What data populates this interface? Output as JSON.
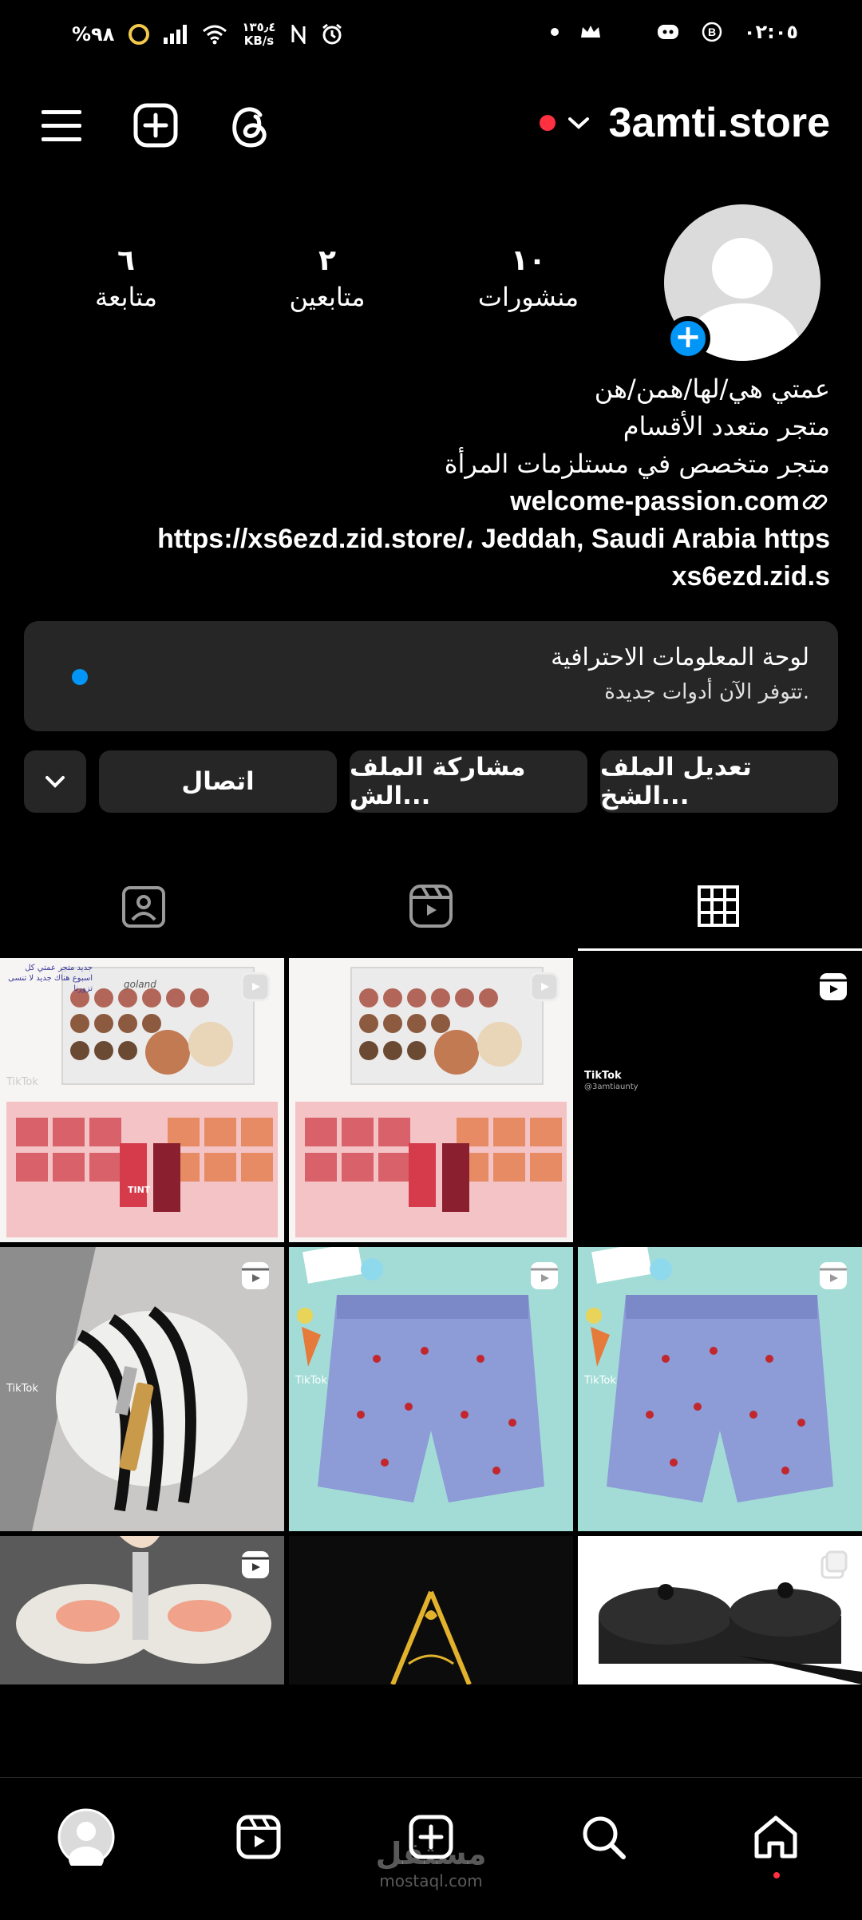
{
  "status_bar": {
    "battery": "%٩٨",
    "speed_value": "١٣٥٫٤",
    "speed_unit": "KB/s",
    "time": "٠٢:٠٥"
  },
  "header": {
    "username": "3amti.store"
  },
  "stats": {
    "posts_count": "١٠",
    "posts_label": "منشورات",
    "followers_count": "٢",
    "followers_label": "متابعين",
    "following_count": "٦",
    "following_label": "متابعة"
  },
  "bio": {
    "line1": "عمتي هي/لها/همن/هن",
    "line2": "متجر متعدد الأقسام",
    "line3": "متجر متخصص في مستلزمات المرأة",
    "link": "welcome-passion.com",
    "line5": "https://xs6ezd.zid.store/، Jeddah, Saudi Arabia https",
    "line6": "xs6ezd.zid.s"
  },
  "dashboard": {
    "title": "لوحة المعلومات الاحترافية",
    "subtitle": "تتوفر الآن أدوات جديدة."
  },
  "buttons": {
    "edit": "تعديل الملف الشخ...",
    "share": "مشاركة الملف الش...",
    "contact": "اتصال"
  },
  "grid": {
    "tiktok_label": "TikTok",
    "tiktok_handle": "@3amtiaunty",
    "palette_brand": "goland",
    "tint_label": "TINT",
    "promo_text": "جديد متجر عمتي كل اسبوع هناك جديد لا تنسى تزورنا"
  },
  "watermark": {
    "text": "مستقل",
    "sub": "mostaql.com"
  },
  "colors": {
    "accent_blue": "#0095f6",
    "notification_red": "#ff3040",
    "surface": "#262626"
  }
}
